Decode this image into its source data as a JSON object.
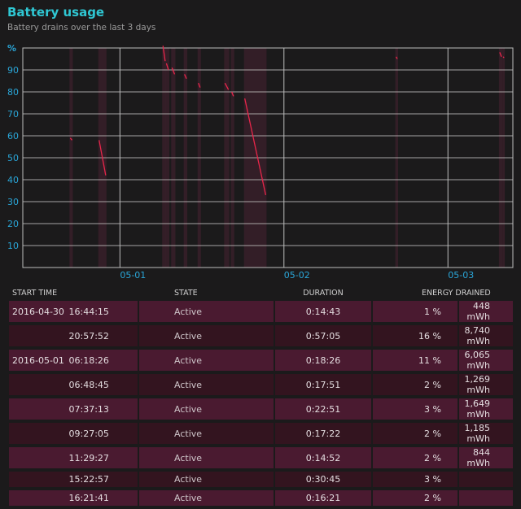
{
  "header": {
    "title": "Battery usage",
    "subtitle": "Battery drains over the last 3 days"
  },
  "chart_data": {
    "type": "line",
    "ylabel": "%",
    "ylim": [
      0,
      100
    ],
    "yticks": [
      10,
      20,
      30,
      40,
      50,
      60,
      70,
      80,
      90
    ],
    "xlim": [
      "2016-04-30T09:47",
      "2016-05-03T09:30"
    ],
    "xticks": [
      {
        "t": "2016-05-01T00:00",
        "label": "05-01"
      },
      {
        "t": "2016-05-02T00:00",
        "label": "05-02"
      },
      {
        "t": "2016-05-03T00:00",
        "label": "05-03"
      }
    ],
    "grid": true,
    "colors": {
      "line": "#e8264a",
      "band": "#3a1f2a",
      "grid": "#bdbdbd",
      "axis_text": "#2aa6d8"
    },
    "segments": [
      {
        "start": "2016-04-30T16:44",
        "end": "2016-04-30T16:59",
        "from": 59,
        "to": 58
      },
      {
        "start": "2016-04-30T20:57",
        "end": "2016-04-30T21:55",
        "from": 58,
        "to": 42
      },
      {
        "start": "2016-05-01T06:18",
        "end": "2016-05-01T06:37",
        "from": 101,
        "to": 94
      },
      {
        "start": "2016-05-01T06:48",
        "end": "2016-05-01T07:06",
        "from": 93,
        "to": 90
      },
      {
        "start": "2016-05-01T07:37",
        "end": "2016-05-01T08:00",
        "from": 91,
        "to": 88
      },
      {
        "start": "2016-05-01T09:27",
        "end": "2016-05-01T09:44",
        "from": 88,
        "to": 86
      },
      {
        "start": "2016-05-01T11:29",
        "end": "2016-05-01T11:44",
        "from": 84,
        "to": 82
      },
      {
        "start": "2016-05-01T15:22",
        "end": "2016-05-01T15:53",
        "from": 84,
        "to": 81
      },
      {
        "start": "2016-05-01T16:21",
        "end": "2016-05-01T16:37",
        "from": 80,
        "to": 78
      },
      {
        "start": "2016-05-01T18:16",
        "end": "2016-05-01T21:20",
        "from": 77,
        "to": 33
      },
      {
        "start": "2016-05-02T16:25",
        "end": "2016-05-02T16:35",
        "from": 96,
        "to": 95
      },
      {
        "start": "2016-05-03T07:35",
        "end": "2016-05-03T07:50",
        "from": 98,
        "to": 96
      },
      {
        "start": "2016-05-03T08:05",
        "end": "2016-05-03T08:12",
        "from": 96,
        "to": 95.5
      }
    ]
  },
  "table": {
    "headers": {
      "start": "START TIME",
      "state": "STATE",
      "duration": "DURATION",
      "energy": "ENERGY DRAINED"
    },
    "rows": [
      {
        "date": "2016-04-30",
        "time": "16:44:15",
        "state": "Active",
        "duration": "0:14:43",
        "percent": "1 %",
        "energy": "448 mWh"
      },
      {
        "date": "",
        "time": "20:57:52",
        "state": "Active",
        "duration": "0:57:05",
        "percent": "16 %",
        "energy": "8,740 mWh"
      },
      {
        "date": "2016-05-01",
        "time": "06:18:26",
        "state": "Active",
        "duration": "0:18:26",
        "percent": "11 %",
        "energy": "6,065 mWh"
      },
      {
        "date": "",
        "time": "06:48:45",
        "state": "Active",
        "duration": "0:17:51",
        "percent": "2 %",
        "energy": "1,269 mWh"
      },
      {
        "date": "",
        "time": "07:37:13",
        "state": "Active",
        "duration": "0:22:51",
        "percent": "3 %",
        "energy": "1,649 mWh"
      },
      {
        "date": "",
        "time": "09:27:05",
        "state": "Active",
        "duration": "0:17:22",
        "percent": "2 %",
        "energy": "1,185 mWh"
      },
      {
        "date": "",
        "time": "11:29:27",
        "state": "Active",
        "duration": "0:14:52",
        "percent": "2 %",
        "energy": "844 mWh"
      },
      {
        "date": "",
        "time": "15:22:57",
        "state": "Active",
        "duration": "0:30:45",
        "percent": "3 %",
        "energy": ""
      },
      {
        "date": "",
        "time": "16:21:41",
        "state": "Active",
        "duration": "0:16:21",
        "percent": "2 %",
        "energy": ""
      }
    ]
  }
}
